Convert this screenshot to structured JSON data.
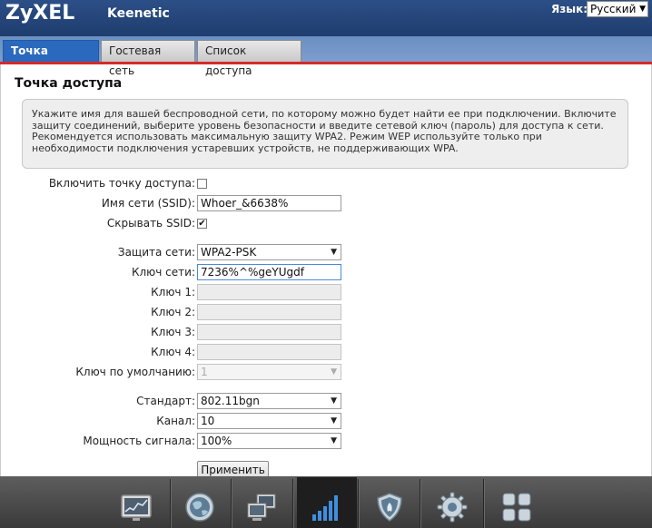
{
  "header": {
    "logo": "ZyXEL",
    "product": "Keenetic",
    "language_label": "Язык:",
    "language_value": "Русский"
  },
  "tabs": [
    {
      "label": "Точка доступа",
      "active": true
    },
    {
      "label": "Гостевая сеть",
      "active": false
    },
    {
      "label": "Список доступа",
      "active": false
    }
  ],
  "page": {
    "title": "Точка доступа",
    "info": "Укажите имя для вашей беспроводной сети, по которому можно будет найти ее при подключении. Включите защиту соединений, выберите уровень безопасности и введите сетевой ключ (пароль) для доступа к сети. Рекомендуется использовать максимальную защиту WPA2. Режим WEP используйте только при необходимости подключения устаревших устройств, не поддерживающих WPA."
  },
  "form": {
    "enable_ap_label": "Включить точку доступа:",
    "enable_ap_checked": false,
    "ssid_label": "Имя сети (SSID):",
    "ssid_value": "Whoer_&6638%",
    "hide_ssid_label": "Скрывать SSID:",
    "hide_ssid_checked": true,
    "security_label": "Защита сети:",
    "security_value": "WPA2-PSK",
    "network_key_label": "Ключ сети:",
    "network_key_value": "7236%^%geYUgdf",
    "key1_label": "Ключ 1:",
    "key2_label": "Ключ 2:",
    "key3_label": "Ключ 3:",
    "key4_label": "Ключ 4:",
    "default_key_label": "Ключ по умолчанию:",
    "default_key_value": "1",
    "standard_label": "Стандарт:",
    "standard_value": "802.11bgn",
    "channel_label": "Канал:",
    "channel_value": "10",
    "power_label": "Мощность сигнала:",
    "power_value": "100%",
    "apply_label": "Применить"
  },
  "dock": {
    "items": [
      {
        "icon": "monitor-chart-icon"
      },
      {
        "icon": "globe-icon"
      },
      {
        "icon": "computers-network-icon"
      },
      {
        "icon": "wifi-signal-bars-icon",
        "active": true
      },
      {
        "icon": "shield-icon"
      },
      {
        "icon": "gear-icon"
      },
      {
        "icon": "grid-apps-icon"
      }
    ]
  },
  "colors": {
    "header_bg": "#2c4f87",
    "tab_active": "#2a69bd",
    "red_line": "#d32b2b",
    "dock_bg": "#4a4a4a"
  }
}
